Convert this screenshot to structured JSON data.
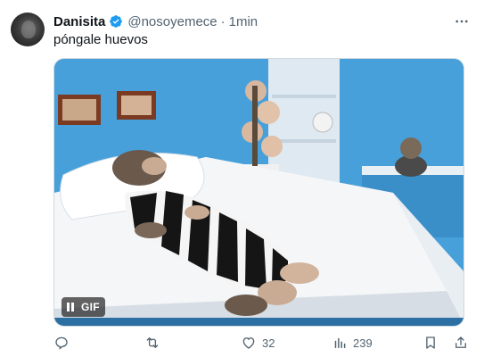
{
  "tweet": {
    "display_name": "Danisita",
    "handle": "@nosoyemece",
    "separator": "·",
    "time": "1min",
    "text": "póngale huevos"
  },
  "media": {
    "gif_label": "GIF"
  },
  "actions": {
    "replies": "",
    "retweets": "",
    "likes": "32",
    "views": "239"
  },
  "colors": {
    "verified": "#1d9bf0",
    "secondary_text": "#536471",
    "primary_text": "#0f1419"
  },
  "icons": [
    "verified-badge-icon",
    "more-options-icon",
    "pause-icon",
    "reply-icon",
    "retweet-icon",
    "like-icon",
    "views-icon",
    "bookmark-icon",
    "share-icon"
  ]
}
